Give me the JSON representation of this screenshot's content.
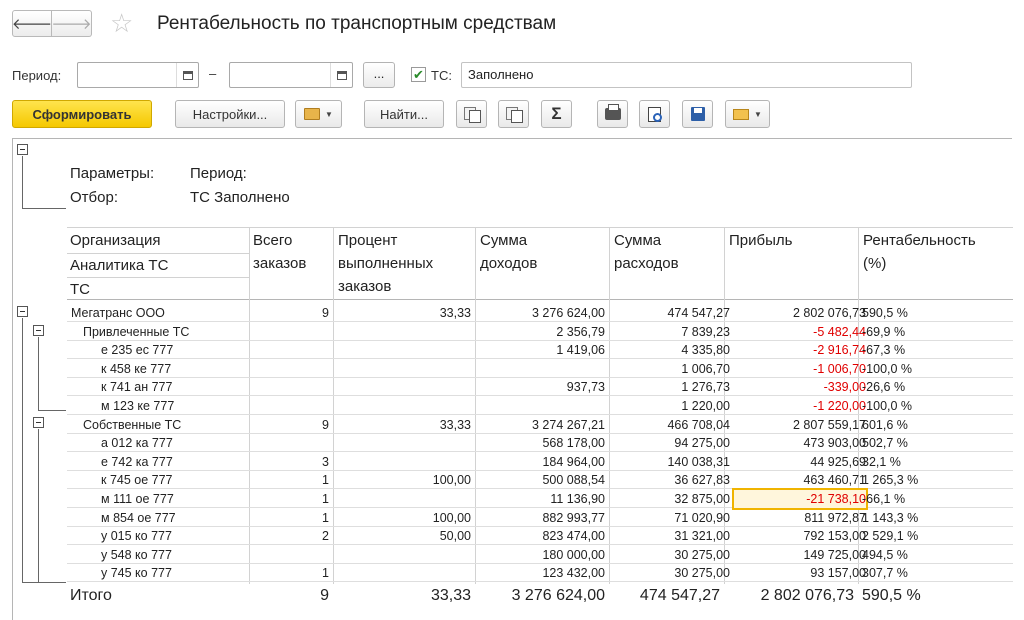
{
  "window": {
    "title": "Рентабельность по транспортным средствам"
  },
  "nav": {
    "back": "🡐",
    "forward": "🡒",
    "favorite": "☆"
  },
  "filters": {
    "period_label": "Период:",
    "dash": "–",
    "date_from": "",
    "date_to": "",
    "select_button": "...",
    "ts_label": "ТС:",
    "ts_checked": true,
    "ts_value": "Заполнено"
  },
  "toolbar": {
    "generate": "Сформировать",
    "settings": "Настройки...",
    "find": "Найти...",
    "sum": "Σ"
  },
  "report": {
    "params_label": "Параметры:",
    "params_value": "Период:",
    "filter_label": "Отбор:",
    "filter_value": "ТС Заполнено",
    "headers": {
      "org": "Организация",
      "analytics": "Аналитика ТС",
      "ts": "ТС",
      "orders": [
        "Всего",
        "заказов"
      ],
      "percent": [
        "Процент",
        "выполненных",
        "заказов"
      ],
      "income": [
        "Сумма",
        "доходов"
      ],
      "expense": [
        "Сумма",
        "расходов"
      ],
      "profit": "Прибыль",
      "rentability": [
        "Рентабельность",
        "(%)"
      ]
    },
    "rows": [
      {
        "name": "Мегатранс ООО",
        "orders": "9",
        "percent": "33,33",
        "income": "3 276 624,00",
        "expense": "474 547,27",
        "profit": "2 802 076,73",
        "rent": "590,5 %"
      },
      {
        "name": "Привлеченные ТС",
        "orders": "",
        "percent": "",
        "income": "2 356,79",
        "expense": "7 839,23",
        "profit": "-5 482,44",
        "rent": "-69,9 %"
      },
      {
        "name": "е 235 ес 777",
        "orders": "",
        "percent": "",
        "income": "1 419,06",
        "expense": "4 335,80",
        "profit": "-2 916,74",
        "rent": "-67,3 %"
      },
      {
        "name": "к 458 ке 777",
        "orders": "",
        "percent": "",
        "income": "",
        "expense": "1 006,70",
        "profit": "-1 006,70",
        "rent": "-100,0 %"
      },
      {
        "name": "к 741 ан 777",
        "orders": "",
        "percent": "",
        "income": "937,73",
        "expense": "1 276,73",
        "profit": "-339,00",
        "rent": "-26,6 %"
      },
      {
        "name": "м 123 ке 777",
        "orders": "",
        "percent": "",
        "income": "",
        "expense": "1 220,00",
        "profit": "-1 220,00",
        "rent": "-100,0 %"
      },
      {
        "name": "Собственные ТС",
        "orders": "9",
        "percent": "33,33",
        "income": "3 274 267,21",
        "expense": "466 708,04",
        "profit": "2 807 559,17",
        "rent": "601,6 %"
      },
      {
        "name": "а 012 ка 777",
        "orders": "",
        "percent": "",
        "income": "568 178,00",
        "expense": "94 275,00",
        "profit": "473 903,00",
        "rent": "502,7 %"
      },
      {
        "name": "е 742 ка 777",
        "orders": "3",
        "percent": "",
        "income": "184 964,00",
        "expense": "140 038,31",
        "profit": "44 925,69",
        "rent": "32,1 %"
      },
      {
        "name": "к 745 ое 777",
        "orders": "1",
        "percent": "100,00",
        "income": "500 088,54",
        "expense": "36 627,83",
        "profit": "463 460,71",
        "rent": "1 265,3 %"
      },
      {
        "name": "м 111 ое 777",
        "orders": "1",
        "percent": "",
        "income": "11 136,90",
        "expense": "32 875,00",
        "profit": "-21 738,10",
        "rent": "-66,1 %"
      },
      {
        "name": "м 854 ое 777",
        "orders": "1",
        "percent": "100,00",
        "income": "882 993,77",
        "expense": "71 020,90",
        "profit": "811 972,87",
        "rent": "1 143,3 %"
      },
      {
        "name": "у 015 ко 777",
        "orders": "2",
        "percent": "50,00",
        "income": "823 474,00",
        "expense": "31 321,00",
        "profit": "792 153,00",
        "rent": "2 529,1 %"
      },
      {
        "name": "у 548 ко 777",
        "orders": "",
        "percent": "",
        "income": "180 000,00",
        "expense": "30 275,00",
        "profit": "149 725,00",
        "rent": "494,5 %"
      },
      {
        "name": "у 745 ко 777",
        "orders": "1",
        "percent": "",
        "income": "123 432,00",
        "expense": "30 275,00",
        "profit": "93 157,00",
        "rent": "307,7 %"
      }
    ],
    "total": {
      "name": "Итого",
      "orders": "9",
      "percent": "33,33",
      "income": "3 276 624,00",
      "expense": "474 547,27",
      "profit": "2 802 076,73",
      "rent": "590,5 %"
    }
  },
  "colors": {
    "negative": "#e00000",
    "primary_button": "#f5c800",
    "selection": "#f0b400"
  }
}
